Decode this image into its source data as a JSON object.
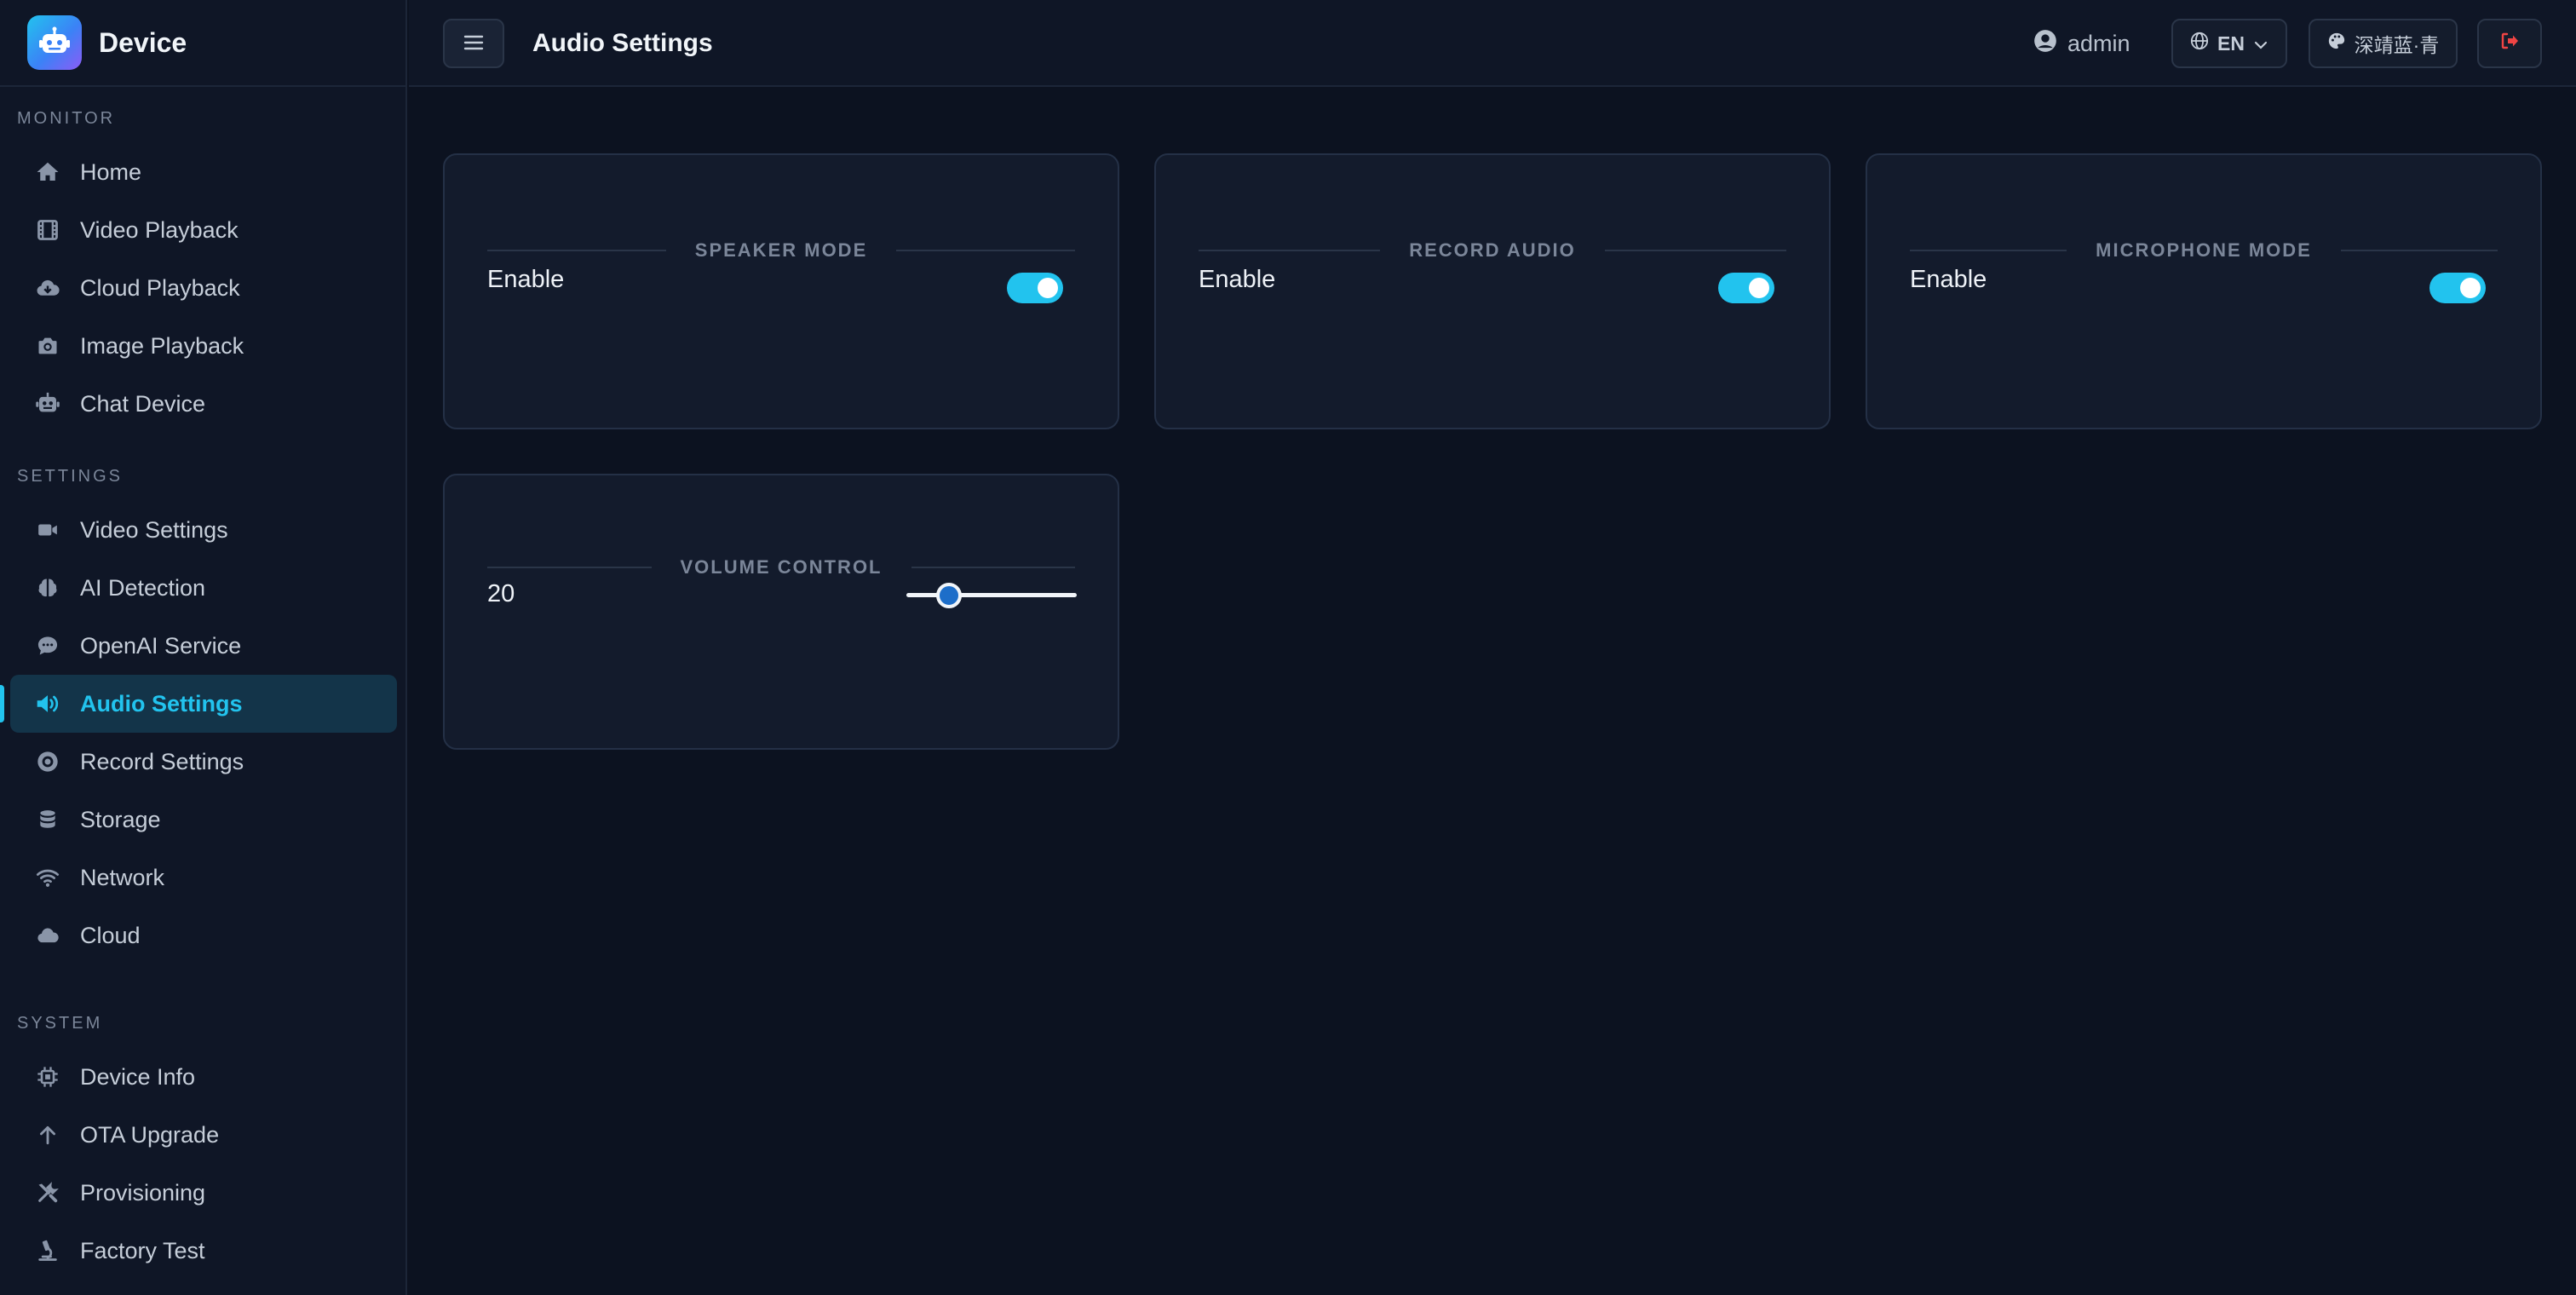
{
  "app": {
    "name": "Device"
  },
  "sidebar": {
    "sections": [
      {
        "title": "MONITOR",
        "items": [
          {
            "label": "Home",
            "icon": "home-icon"
          },
          {
            "label": "Video Playback",
            "icon": "film-icon"
          },
          {
            "label": "Cloud Playback",
            "icon": "cloud-download-icon"
          },
          {
            "label": "Image Playback",
            "icon": "camera-icon"
          },
          {
            "label": "Chat Device",
            "icon": "robot-icon"
          }
        ]
      },
      {
        "title": "SETTINGS",
        "items": [
          {
            "label": "Video Settings",
            "icon": "video-icon"
          },
          {
            "label": "AI Detection",
            "icon": "brain-icon"
          },
          {
            "label": "OpenAI Service",
            "icon": "chat-icon"
          },
          {
            "label": "Audio Settings",
            "icon": "speaker-icon",
            "active": true
          },
          {
            "label": "Record Settings",
            "icon": "record-icon"
          },
          {
            "label": "Storage",
            "icon": "database-icon"
          },
          {
            "label": "Network",
            "icon": "wifi-icon"
          },
          {
            "label": "Cloud",
            "icon": "cloud-icon"
          }
        ]
      },
      {
        "title": "SYSTEM",
        "items": [
          {
            "label": "Device Info",
            "icon": "chip-icon"
          },
          {
            "label": "OTA Upgrade",
            "icon": "arrow-up-icon"
          },
          {
            "label": "Provisioning",
            "icon": "tools-icon"
          },
          {
            "label": "Factory Test",
            "icon": "microscope-icon"
          }
        ]
      }
    ]
  },
  "header": {
    "title": "Audio Settings",
    "user": "admin",
    "language": "EN",
    "theme": "深靖蓝·青"
  },
  "cards": {
    "speaker": {
      "title": "SPEAKER MODE",
      "label": "Enable",
      "enabled": true
    },
    "record": {
      "title": "RECORD AUDIO",
      "label": "Enable",
      "enabled": true
    },
    "microphone": {
      "title": "MICROPHONE MODE",
      "label": "Enable",
      "enabled": true
    },
    "volume": {
      "title": "VOLUME CONTROL",
      "value": "20",
      "level": 0.25
    }
  },
  "colors": {
    "accent": "#22c3ee",
    "background": "#0c1220",
    "sidebar": "#0f1626",
    "card": "#131b2c",
    "logout": "#ef4444"
  }
}
